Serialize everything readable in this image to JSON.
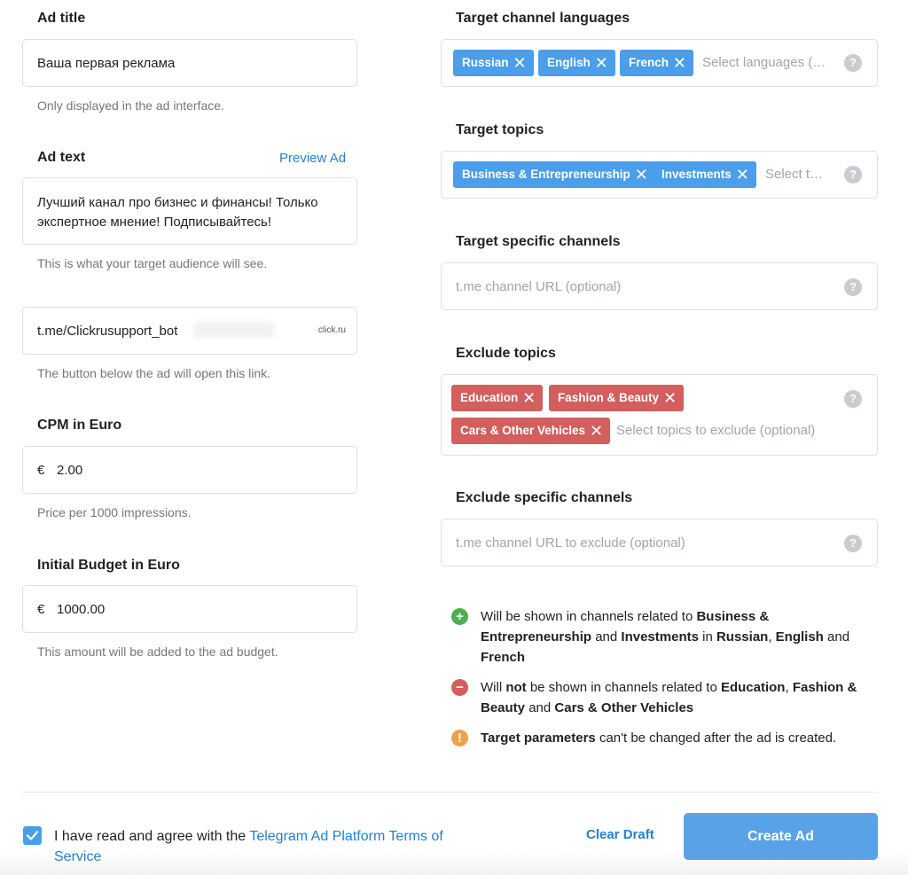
{
  "left": {
    "ad_title": {
      "label": "Ad title",
      "value": "Ваша первая реклама",
      "hint": "Only displayed in the ad interface."
    },
    "ad_text": {
      "label": "Ad text",
      "preview_link": "Preview Ad",
      "value": "Лучший канал про бизнес и финансы! Только экспертное мнение! Подписывайтесь!",
      "hint": "This is what your target audience will see."
    },
    "url": {
      "value": "t.me/Clickrusupport_bot",
      "badge": "click.ru",
      "hint": "The button below the ad will open this link."
    },
    "cpm": {
      "label": "CPM in Euro",
      "currency": "€",
      "value": "2.00",
      "hint": "Price per 1000 impressions."
    },
    "budget": {
      "label": "Initial Budget in Euro",
      "currency": "€",
      "value": "1000.00",
      "hint": "This amount will be added to the ad budget."
    }
  },
  "right": {
    "languages": {
      "label": "Target channel languages",
      "chips": [
        "Russian",
        "English",
        "French"
      ],
      "placeholder": "Select languages (optional)"
    },
    "topics": {
      "label": "Target topics",
      "chips": [
        "Business & Entrepreneurship",
        "Investments"
      ],
      "placeholder": "Select topics"
    },
    "channels": {
      "label": "Target specific channels",
      "placeholder": "t.me channel URL (optional)"
    },
    "exclude_topics": {
      "label": "Exclude topics",
      "chips": [
        "Education",
        "Fashion & Beauty",
        "Cars & Other Vehicles"
      ],
      "placeholder": "Select topics to exclude (optional)"
    },
    "exclude_channels": {
      "label": "Exclude specific channels",
      "placeholder": "t.me channel URL to exclude (optional)"
    },
    "help_glyph": "?",
    "summary": {
      "shown": {
        "icon": "+",
        "p1": "Will be shown in channels related to ",
        "b1": "Business & Entrepreneurship",
        "p2": " and ",
        "b2": "Investments",
        "p3": " in ",
        "b3": "Russian",
        "p4": ", ",
        "b4": "English",
        "p5": " and ",
        "b5": "French"
      },
      "not_shown": {
        "icon": "−",
        "p1": "Will ",
        "b1": "not",
        "p2": " be shown in channels related to ",
        "b2": "Education",
        "p3": ", ",
        "b3": "Fashion & Beauty",
        "p4": " and ",
        "b4": "Cars & Other Vehicles"
      },
      "warning": {
        "icon": "!",
        "b1": "Target parameters",
        "p1": " can't be changed after the ad is created."
      }
    }
  },
  "footer": {
    "agree_text": "I have read and agree with the ",
    "terms_link": "Telegram Ad Platform Terms of Service",
    "clear_draft": "Clear Draft",
    "create_ad": "Create Ad"
  },
  "colors": {
    "accent": "#2481cc",
    "chip_blue": "#4a9eea",
    "chip_red": "#d35e5e",
    "green": "#4caf50",
    "red": "#d35e5e",
    "orange": "#f0a04b"
  },
  "chip_close_glyph": "✕",
  "check_glyph": "✓"
}
